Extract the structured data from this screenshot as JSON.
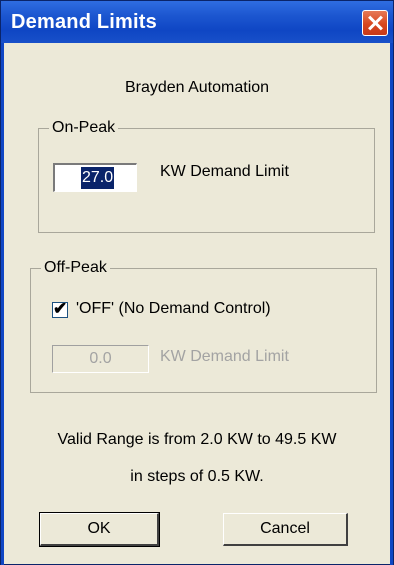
{
  "window": {
    "title": "Demand Limits"
  },
  "company": "Brayden Automation",
  "on_peak": {
    "group_label": "On-Peak",
    "value": "27.0",
    "label": "KW Demand Limit"
  },
  "off_peak": {
    "group_label": "Off-Peak",
    "checkbox_label": "'OFF' (No Demand Control)",
    "checkbox_mark": "✔",
    "checked": true,
    "value": "0.0",
    "label": "KW Demand Limit"
  },
  "valid_range": {
    "line1": "Valid Range is from 2.0 KW to 49.5 KW",
    "line2": "in steps of 0.5 KW."
  },
  "buttons": {
    "ok": "OK",
    "cancel": "Cancel"
  },
  "colors": {
    "titlebar": "#0f46c4",
    "close": "#d8471f",
    "dialog_bg": "#ece9d8",
    "selection": "#0a246a"
  }
}
